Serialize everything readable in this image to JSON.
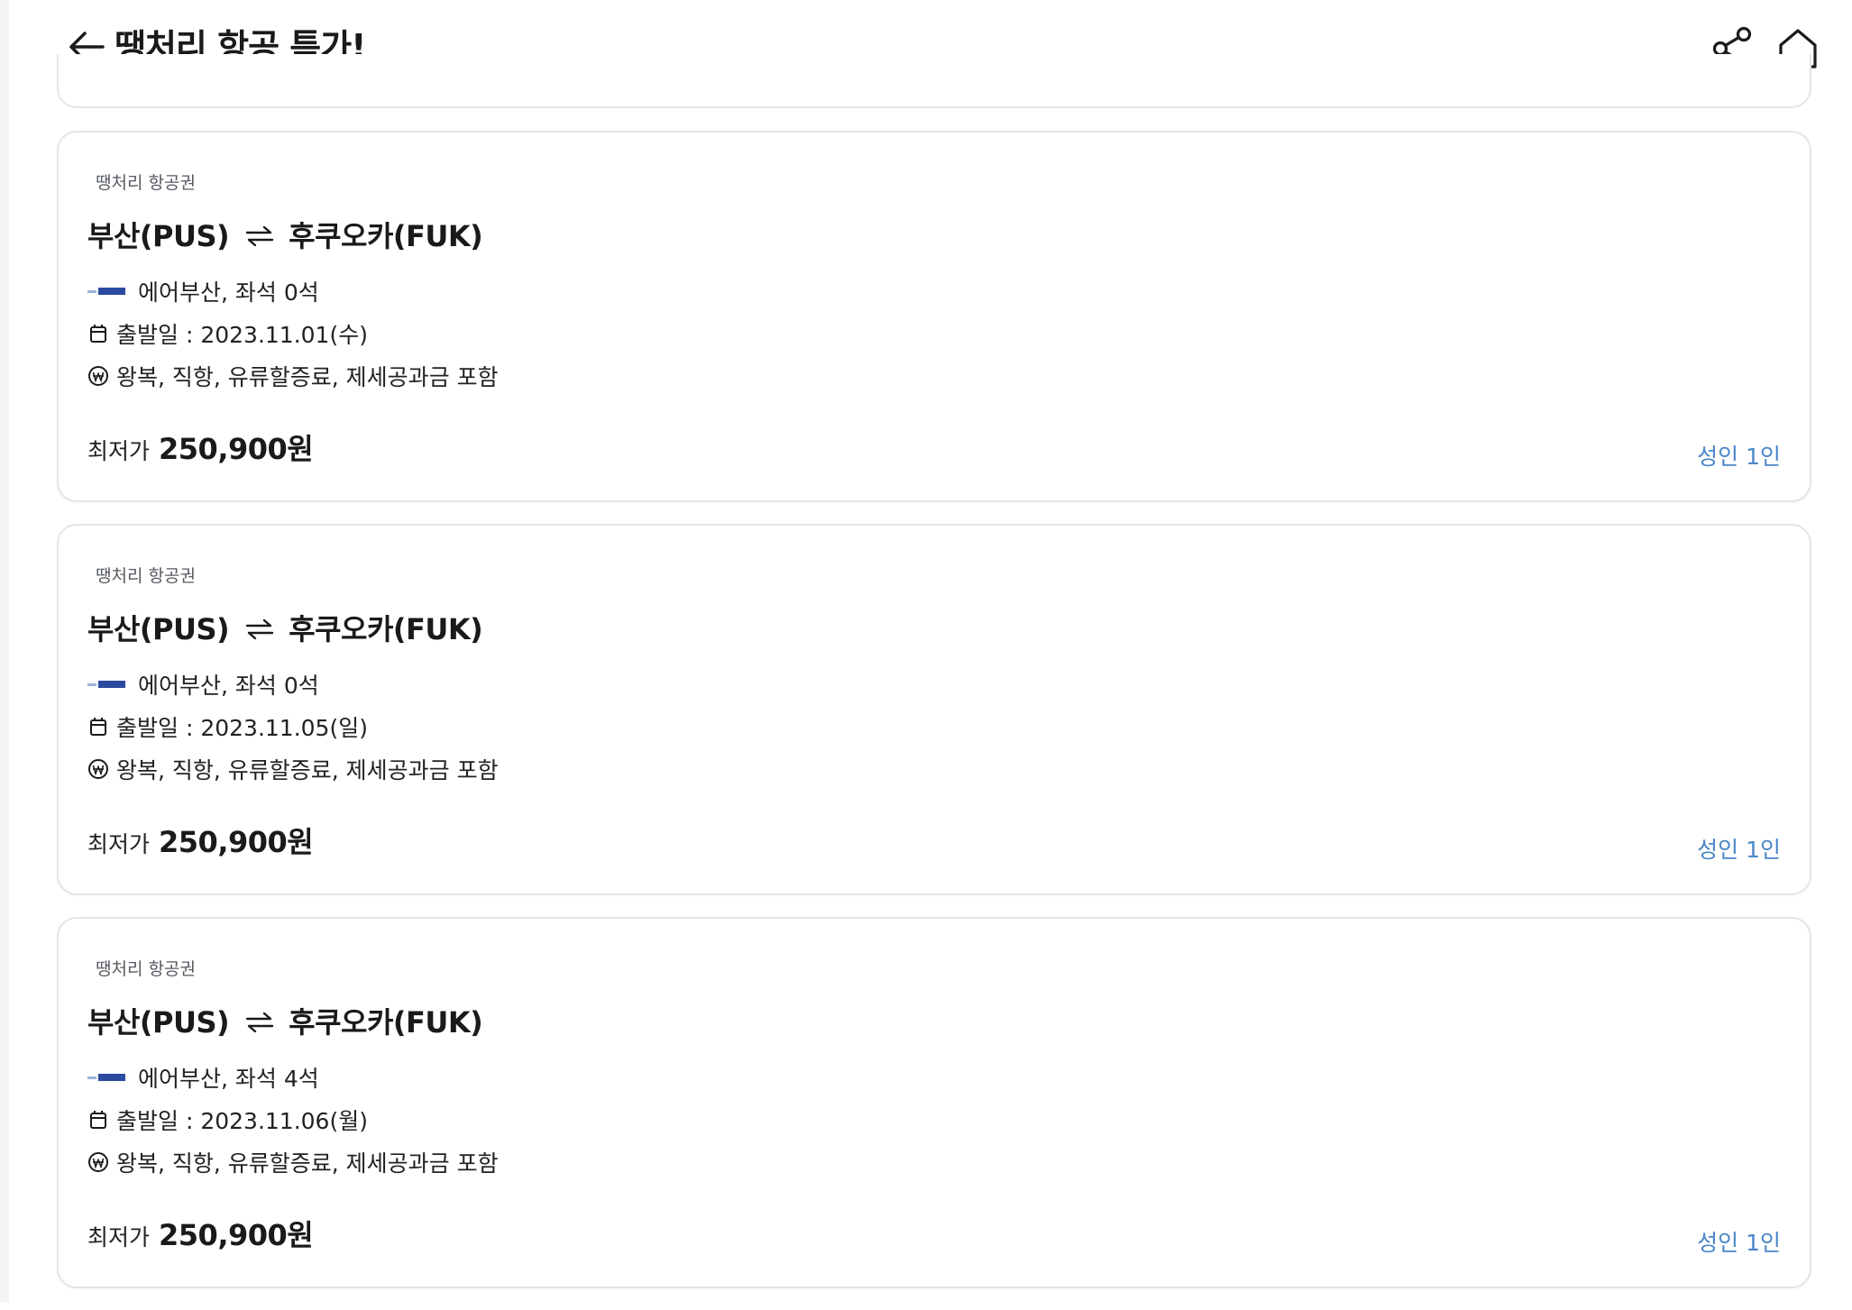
{
  "header": {
    "title": "땡처리 항공 특가!",
    "back_icon": "arrow-left-icon",
    "share_icon": "share-icon",
    "home_icon": "home-icon"
  },
  "colors": {
    "accent_blue": "#4a86c8",
    "card_border": "#e3e5e8",
    "airline_logo": "#2b4aa0"
  },
  "cards": [
    {
      "category": "땡처리 항공권",
      "origin": "부산(PUS)",
      "destination": "후쿠오카(FUK)",
      "airline_seats": "에어부산, 좌석 0석",
      "departure": "출발일 : 2023.11.01(수)",
      "fare_info": "왕복, 직항, 유류할증료, 제세공과금 포함",
      "price_label": "최저가",
      "price": "250,900원",
      "pax": "성인 1인"
    },
    {
      "category": "땡처리 항공권",
      "origin": "부산(PUS)",
      "destination": "후쿠오카(FUK)",
      "airline_seats": "에어부산, 좌석 0석",
      "departure": "출발일 : 2023.11.05(일)",
      "fare_info": "왕복, 직항, 유류할증료, 제세공과금 포함",
      "price_label": "최저가",
      "price": "250,900원",
      "pax": "성인 1인"
    },
    {
      "category": "땡처리 항공권",
      "origin": "부산(PUS)",
      "destination": "후쿠오카(FUK)",
      "airline_seats": "에어부산, 좌석 4석",
      "departure": "출발일 : 2023.11.06(월)",
      "fare_info": "왕복, 직항, 유류할증료, 제세공과금 포함",
      "price_label": "최저가",
      "price": "250,900원",
      "pax": "성인 1인"
    }
  ]
}
